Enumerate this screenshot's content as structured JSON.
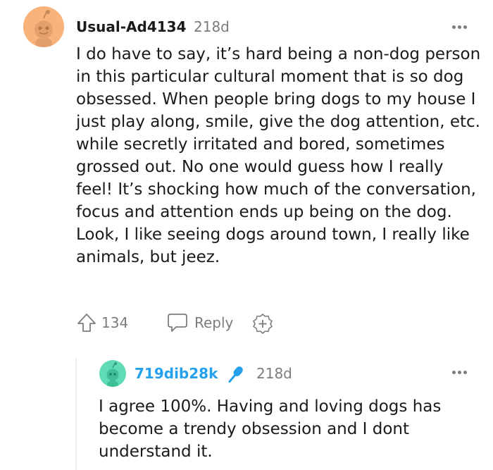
{
  "comment": {
    "username": "Usual-Ad4134",
    "age": "218d",
    "text": "I do have to say, it’s hard being a non-dog person in this particular cultural moment that is so dog obsessed. When people bring dogs to my house I just play along, smile, give the dog attention, etc. while secretly irritated and bored, sometimes grossed out. No one would guess how I really feel! It’s shocking how much of the conversation, focus and attention ends up being on the dog. Look, I like seeing dogs around town, I really like animals, but jeez.",
    "upvotes": "134",
    "reply_label": "Reply",
    "avatar_color": "#f9b37a",
    "icons": [
      "upvote-icon",
      "reply-icon",
      "award-icon",
      "more-options-icon"
    ]
  },
  "reply": {
    "username": "719dib28k",
    "username_color": "#24a0ed",
    "age": "218d",
    "text": "I agree 100%. Having and loving dogs has become a trendy obsession and I dont understand it.",
    "avatar_color": "#5fdcb6",
    "icons": [
      "microphone-icon",
      "more-options-icon"
    ]
  }
}
